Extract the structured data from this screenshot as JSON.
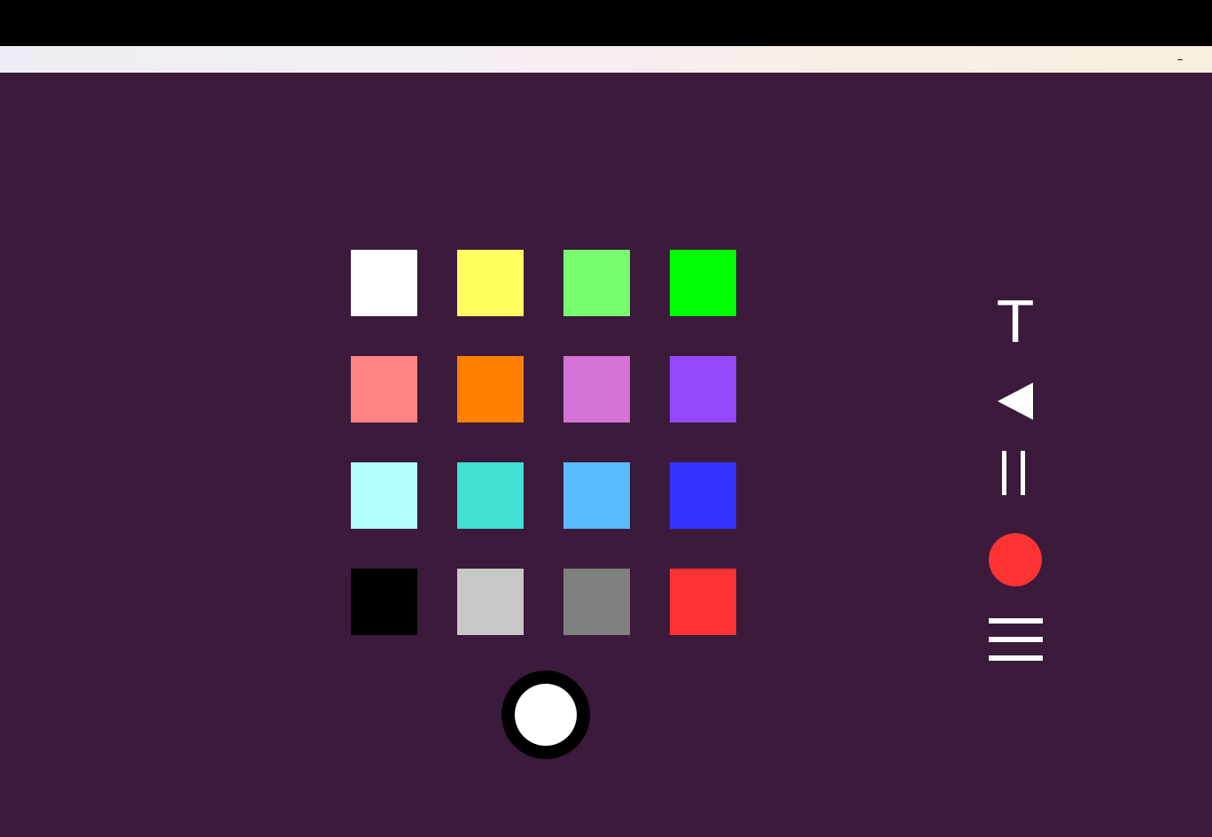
{
  "window": {
    "minimize_label": "–"
  },
  "colors": {
    "background": "#3b1a3c",
    "top_bar": "#000000",
    "icon": "#ffffff",
    "record": "#ff3333",
    "current_ring": "#000000"
  },
  "palette": {
    "swatches": [
      {
        "name": "white",
        "color": "#ffffff"
      },
      {
        "name": "yellow",
        "color": "#ffff60"
      },
      {
        "name": "light-green",
        "color": "#77ff70"
      },
      {
        "name": "green",
        "color": "#00ff00"
      },
      {
        "name": "salmon",
        "color": "#ff8383"
      },
      {
        "name": "orange",
        "color": "#ff8000"
      },
      {
        "name": "orchid",
        "color": "#d673d6"
      },
      {
        "name": "violet",
        "color": "#9449fb"
      },
      {
        "name": "light-cyan",
        "color": "#b1ffff"
      },
      {
        "name": "turquoise",
        "color": "#40e0d3"
      },
      {
        "name": "sky-blue",
        "color": "#5abbff"
      },
      {
        "name": "blue",
        "color": "#3333ff"
      },
      {
        "name": "black",
        "color": "#000000"
      },
      {
        "name": "light-gray",
        "color": "#c8c7c8"
      },
      {
        "name": "gray",
        "color": "#808080"
      },
      {
        "name": "red",
        "color": "#ff3333"
      }
    ]
  },
  "current_color": {
    "color": "#ffffff"
  },
  "tools": {
    "text_label": "T",
    "back_icon": "back-triangle-icon",
    "pause_icon": "pause-icon",
    "record_icon": "record-icon",
    "menu_icon": "hamburger-menu-icon"
  }
}
